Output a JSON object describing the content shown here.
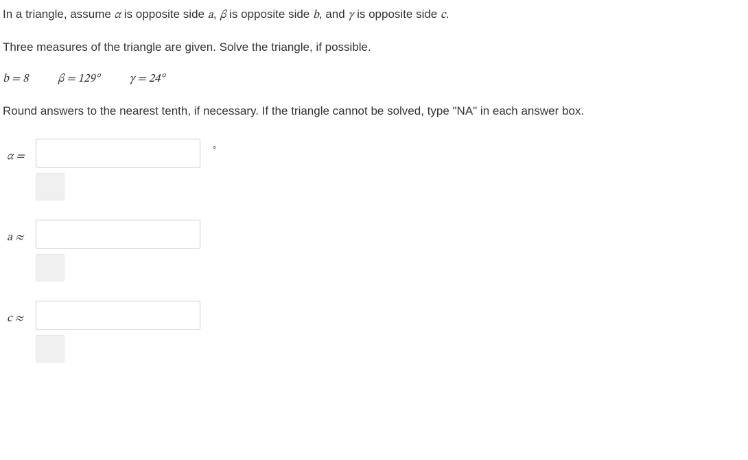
{
  "intro": {
    "line1_pre": "In a triangle, assume ",
    "line1_alpha": "α",
    "line1_mid1": " is opposite side ",
    "line1_a": "a",
    "line1_comma": ", ",
    "line1_beta": "β",
    "line1_mid2": " is opposite side ",
    "line1_b": "b",
    "line1_and": ", and ",
    "line1_gamma": "γ",
    "line1_mid3": " is opposite side ",
    "line1_c": "c",
    "line1_period": "."
  },
  "line2": "Three measures of the triangle are given. Solve the triangle, if possible.",
  "given": {
    "b": "b = 8",
    "beta": "β = 129°",
    "gamma": "γ = 24°"
  },
  "line3": "Round answers to the nearest tenth, if necessary. If the triangle cannot be solved, type \"NA\" in each answer box.",
  "answers": {
    "alpha_label": "α =",
    "a_label": "a ≈",
    "c_label": "c ≈",
    "degree_suffix": "°"
  }
}
